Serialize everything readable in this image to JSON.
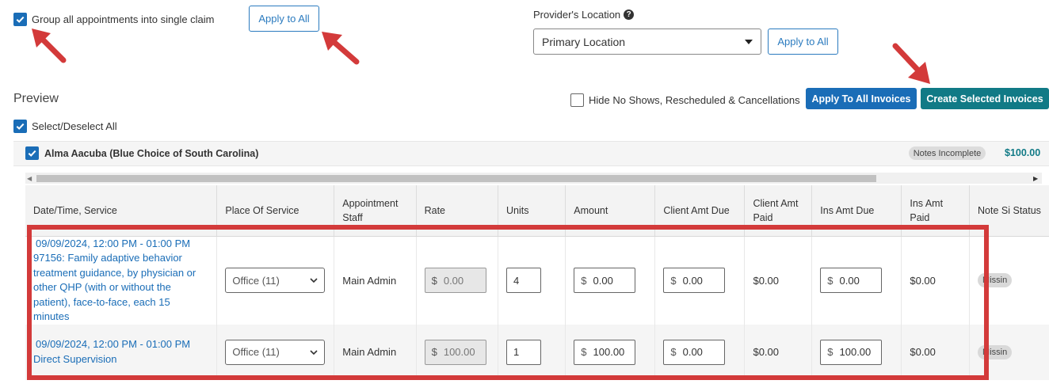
{
  "group_claim": {
    "checked": true,
    "label": "Group all appointments into single claim",
    "apply_label": "Apply to All"
  },
  "provider_location": {
    "label": "Provider's Location",
    "selected": "Primary Location",
    "apply_label": "Apply to All"
  },
  "preview": {
    "title": "Preview",
    "hide_label": "Hide No Shows, Rescheduled & Cancellations",
    "apply_all_invoices_label": "Apply To All Invoices",
    "create_selected_label": "Create Selected Invoices",
    "select_all_label": "Select/Deselect All"
  },
  "client": {
    "name": "Alma Aacuba (Blue Choice of South Carolina)",
    "badge": "Notes Incomplete",
    "total": "$100.00"
  },
  "table": {
    "headers": {
      "date_service": "Date/Time, Service",
      "place": "Place Of Service",
      "staff": "Appointment Staff",
      "rate": "Rate",
      "units": "Units",
      "amount": "Amount",
      "client_due": "Client Amt Due",
      "client_paid": "Client Amt Paid",
      "ins_due": "Ins Amt Due",
      "ins_paid": "Ins Amt Paid",
      "note": "Note Si Status"
    },
    "currency": "$",
    "rows": [
      {
        "datetime": "09/09/2024, 12:00 PM - 01:00 PM",
        "service": "97156: Family adaptive behavior treatment guidance, by physician or other QHP (with or without the patient), face-to-face, each 15 minutes",
        "place": "Office (11)",
        "staff": "Main Admin",
        "rate": "0.00",
        "units": "4",
        "amount": "0.00",
        "client_due": "0.00",
        "client_paid": "$0.00",
        "ins_due": "0.00",
        "ins_paid": "$0.00",
        "status": "Missin"
      },
      {
        "datetime": "09/09/2024, 12:00 PM - 01:00 PM",
        "service": "Direct Supervision",
        "place": "Office (11)",
        "staff": "Main Admin",
        "rate": "100.00",
        "units": "1",
        "amount": "100.00",
        "client_due": "0.00",
        "client_paid": "$0.00",
        "ins_due": "100.00",
        "ins_paid": "$0.00",
        "status": "Missin"
      }
    ]
  },
  "colors": {
    "primary": "#1a6db7",
    "teal": "#117a86",
    "highlight": "#d33a3a"
  },
  "icons": [
    "check-icon",
    "help-icon",
    "caret-down-icon",
    "chevron-down-icon",
    "arrow-pointer-icon",
    "scroll-left-icon",
    "scroll-right-icon"
  ]
}
